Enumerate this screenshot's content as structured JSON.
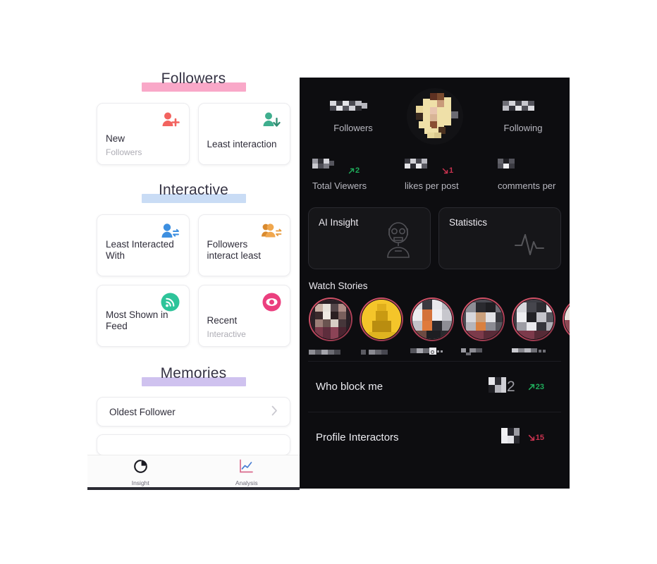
{
  "left_panel": {
    "sections": [
      {
        "id": "followers",
        "title": "Followers",
        "bar_color": "#f9a8c8",
        "cards": [
          {
            "title": "New",
            "subtitle": "Followers",
            "icon": "person-add-icon",
            "icon_color": "#f2635f"
          },
          {
            "title": "Least interaction",
            "subtitle": "",
            "icon": "person-down-icon",
            "icon_color": "#3fae8e"
          }
        ]
      },
      {
        "id": "interactive",
        "title": "Interactive",
        "bar_color": "#c9dcf5",
        "cards": [
          {
            "title": "Least Interacted With",
            "subtitle": "",
            "icon": "person-swap-icon",
            "icon_color": "#3d8fe0"
          },
          {
            "title": "Followers interact least",
            "subtitle": "",
            "icon": "people-swap-icon",
            "icon_color": "#e79a3c"
          }
        ],
        "cards2": [
          {
            "title": "Most Shown in Feed",
            "subtitle": "",
            "icon": "signal-circle-icon",
            "icon_color": "#2ec49a"
          },
          {
            "title": "Recent",
            "subtitle": "Interactive",
            "icon": "eye-circle-icon",
            "icon_color": "#eb3f7e"
          }
        ]
      },
      {
        "id": "memories",
        "title": "Memories",
        "bar_color": "#cfc2ef",
        "rows": [
          {
            "title": "Oldest Follower",
            "chevron": "chevron-right-icon"
          }
        ]
      }
    ],
    "tabbar": {
      "tabs": [
        {
          "label": "Insight",
          "icon": "pie-chart-icon",
          "active": true
        },
        {
          "label": "Analysis",
          "icon": "line-chart-icon",
          "active": false
        }
      ]
    }
  },
  "right_panel": {
    "header": {
      "avatar": "profile-avatar-censored",
      "stats": [
        {
          "label": "Followers",
          "value": "",
          "censored": true
        },
        {
          "label": "Following",
          "value": "",
          "censored": true
        }
      ]
    },
    "mini_stats": [
      {
        "label": "Total Viewers",
        "value": "",
        "censored": true,
        "delta": "2",
        "delta_dir": "up",
        "delta_color": "#1faa5a"
      },
      {
        "label": "likes per post",
        "value": "",
        "censored": true,
        "delta": "1",
        "delta_dir": "down",
        "delta_color": "#c9324f"
      },
      {
        "label": "comments per",
        "value": "",
        "censored": true,
        "delta": "",
        "delta_dir": "",
        "delta_color": ""
      }
    ],
    "big_cards": [
      {
        "title": "AI Insight",
        "icon": "robot-icon"
      },
      {
        "title": "Statistics",
        "icon": "pulse-icon"
      }
    ],
    "watch_stories": {
      "title": "Watch Stories",
      "items": [
        {
          "name": "",
          "censored": true
        },
        {
          "name": "",
          "censored": true
        },
        {
          "name": "",
          "censored": true
        },
        {
          "name": "",
          "censored": true
        },
        {
          "name": "",
          "censored": true
        },
        {
          "name": "",
          "censored": true
        }
      ]
    },
    "rows": [
      {
        "title": "Who block me",
        "value": "",
        "censored": true,
        "delta": "23",
        "delta_dir": "up"
      },
      {
        "title": "Profile Interactors",
        "value": "",
        "censored": true,
        "delta": "15",
        "delta_dir": "down"
      }
    ]
  }
}
